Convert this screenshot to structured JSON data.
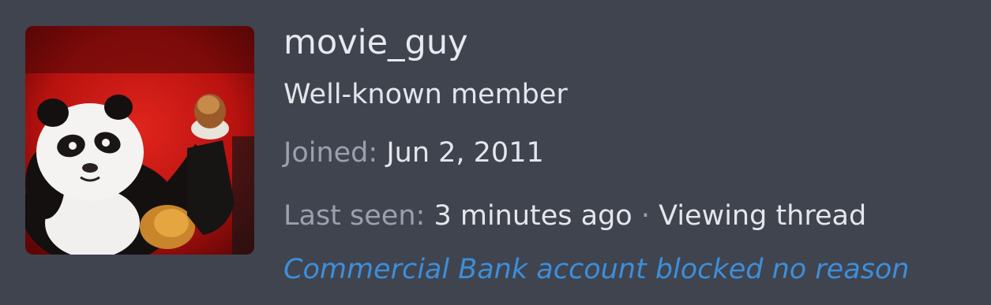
{
  "profile": {
    "avatar_icon": "panda-avatar-icon",
    "username": "movie_guy",
    "user_title": "Well-known member",
    "joined_label": "Joined:",
    "joined_value": "Jun 2, 2011",
    "last_seen_label": "Last seen:",
    "last_seen_value": "3 minutes ago",
    "separator": "·",
    "activity": "Viewing thread",
    "signature_link": "Commercial Bank account blocked no reason"
  },
  "colors": {
    "background": "#40444f",
    "primary_text": "#e4e6ec",
    "muted_text": "#9aa0b0",
    "link": "#3d8ed9"
  }
}
